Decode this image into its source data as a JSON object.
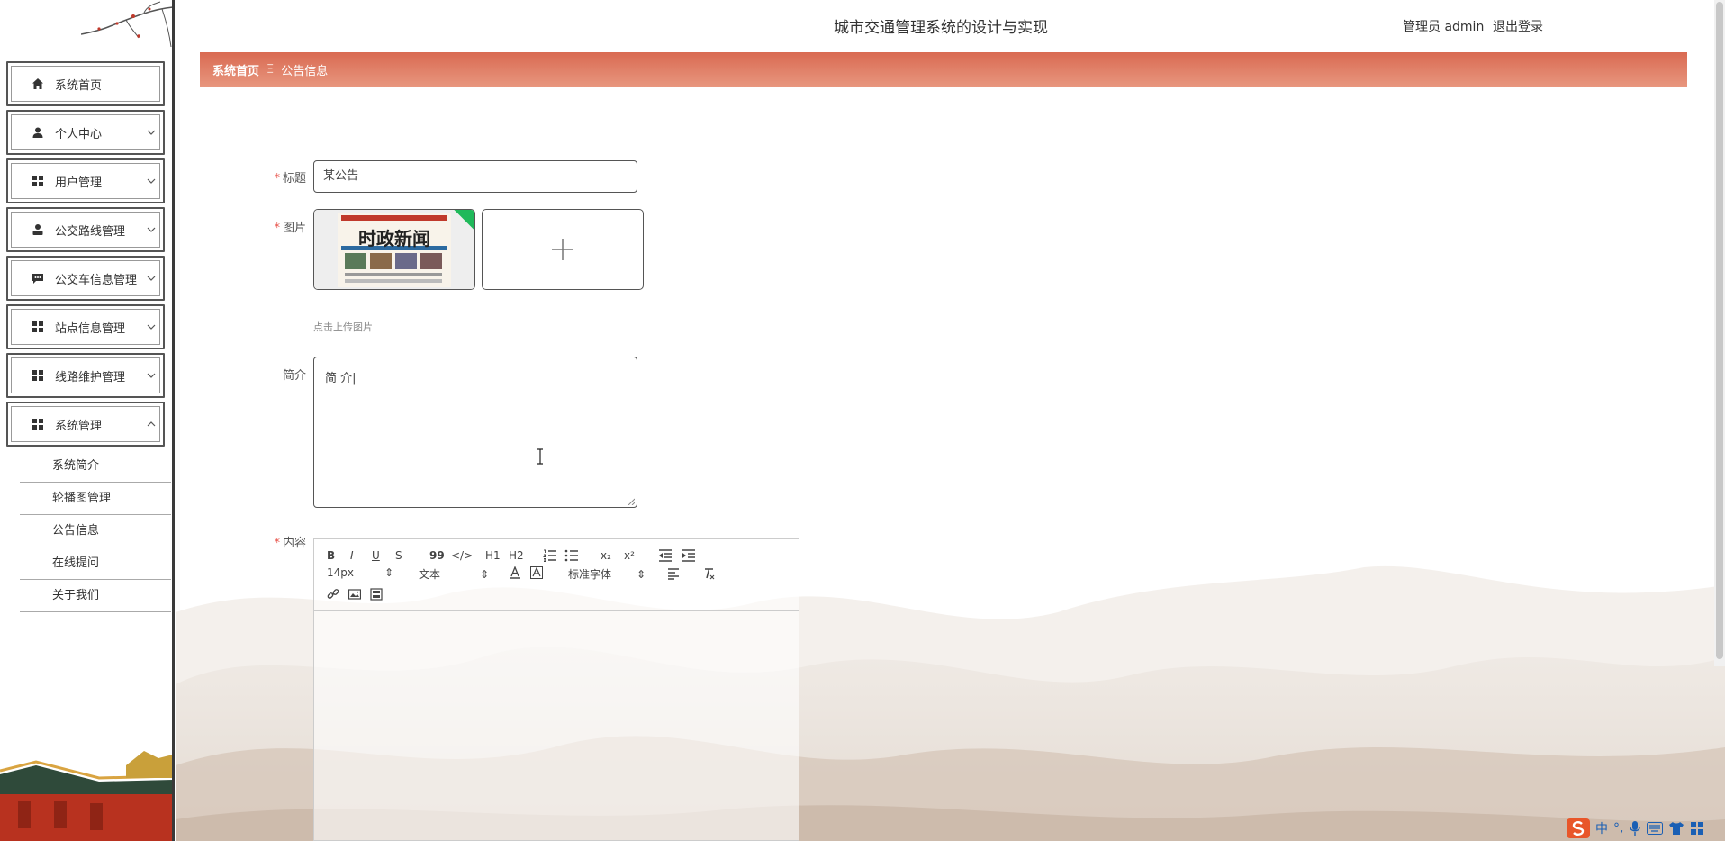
{
  "header": {
    "title": "城市交通管理系统的设计与实现",
    "user": "管理员 admin",
    "logout": "退出登录"
  },
  "sidebar": {
    "items": [
      {
        "label": "系统首页",
        "icon": "home-icon",
        "expandable": false
      },
      {
        "label": "个人中心",
        "icon": "user-icon",
        "expandable": true
      },
      {
        "label": "用户管理",
        "icon": "grid-icon",
        "expandable": true
      },
      {
        "label": "公交路线管理",
        "icon": "person-icon",
        "expandable": true
      },
      {
        "label": "公交车信息管理",
        "icon": "chat-icon",
        "expandable": true
      },
      {
        "label": "站点信息管理",
        "icon": "grid-icon",
        "expandable": true
      },
      {
        "label": "线路维护管理",
        "icon": "grid-icon",
        "expandable": true
      },
      {
        "label": "系统管理",
        "icon": "grid-icon",
        "expandable": true,
        "expanded": true
      }
    ],
    "submenu": [
      "系统简介",
      "轮播图管理",
      "公告信息",
      "在线提问",
      "关于我们"
    ]
  },
  "breadcrumb": {
    "home": "系统首页",
    "separator": "Ξ",
    "current": "公告信息"
  },
  "form": {
    "title_label": "标题",
    "title_value": "某公告",
    "image_label": "图片",
    "image_text": "时政新闻",
    "upload_hint": "点击上传图片",
    "intro_label": "简介",
    "intro_value": "简 介|",
    "content_label": "内容",
    "required_mark": "*"
  },
  "editor": {
    "font_size": "14px",
    "text_type": "文本",
    "font_family": "标准字体",
    "buttons": {
      "bold": "B",
      "italic": "I",
      "underline": "U",
      "strike": "S",
      "quote": "99",
      "code": "</>",
      "h1": "H1",
      "h2": "H2",
      "sub": "x₂",
      "sup": "x²"
    }
  },
  "ime": {
    "lang": "中",
    "punct": "°,"
  },
  "colors": {
    "accent": "#d96a52",
    "required": "#e8534a",
    "ime": "#1a5fb4"
  }
}
